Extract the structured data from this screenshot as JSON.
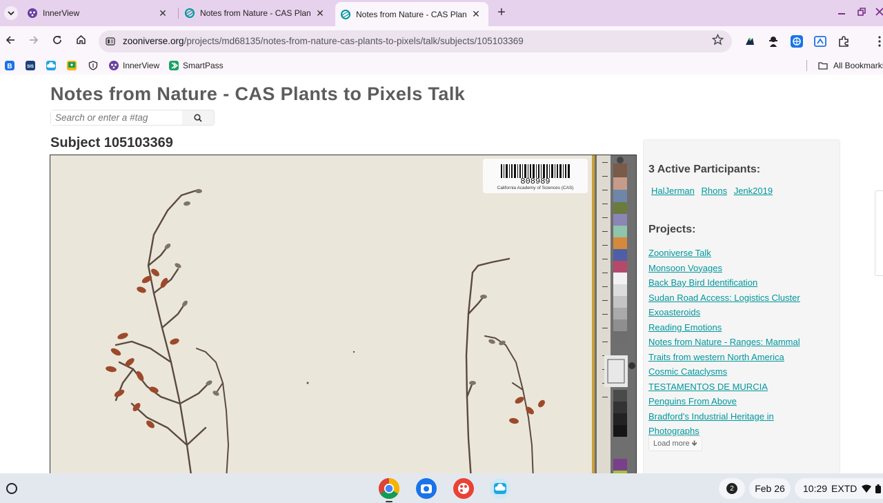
{
  "browser": {
    "tabs": [
      {
        "title": "InnerView",
        "active": false
      },
      {
        "title": "Notes from Nature - CAS Plant",
        "active": false
      },
      {
        "title": "Notes from Nature - CAS Plant",
        "active": true
      }
    ],
    "tab_close_glyph": "✕",
    "new_tab_glyph": "+",
    "url_host": "zooniverse.org",
    "url_path": "/projects/md68135/notes-from-nature-cas-plants-to-pixels/talk/subjects/105103369",
    "bookmarks": [
      {
        "label": "InnerView"
      },
      {
        "label": "SmartPass"
      }
    ],
    "all_bookmarks_label": "All Bookmarks"
  },
  "page": {
    "title": "Notes from Nature - CAS Plants to Pixels Talk",
    "search_placeholder": "Search or enter a #tag",
    "subject_heading": "Subject 105103369",
    "specimen": {
      "barcode_number": "808989",
      "institution": "California Academy of Sciences (CAS)"
    },
    "sidebar": {
      "participants_heading": "3 Active Participants:",
      "participants": [
        "HalJerman",
        "Rhons",
        "Jenk2019"
      ],
      "projects_heading": "Projects:",
      "projects": [
        "Zooniverse Talk",
        "Monsoon Voyages",
        "Back Bay Bird Identification",
        "Sudan Road Access: Logistics Cluster",
        "Exoasteroids",
        "Reading Emotions",
        "Notes from Nature - Ranges: Mammal ",
        "Traits from western North America",
        "Cosmic Cataclysms ",
        "TESTAMENTOS DE MURCIA",
        "Penguins From Above",
        "Bradford's Industrial Heritage in ",
        "Photographs"
      ],
      "load_more_label": "Load more 🡻"
    }
  },
  "shelf": {
    "notification_count": "2",
    "date": "Feb 26",
    "time": "10:29",
    "display_mode": "EXTD"
  },
  "colors": {
    "link": "#00979d",
    "tabstrip": "#e6d2ec",
    "toolbar": "#fbf6fc",
    "shelf": "#e3e8ee"
  }
}
